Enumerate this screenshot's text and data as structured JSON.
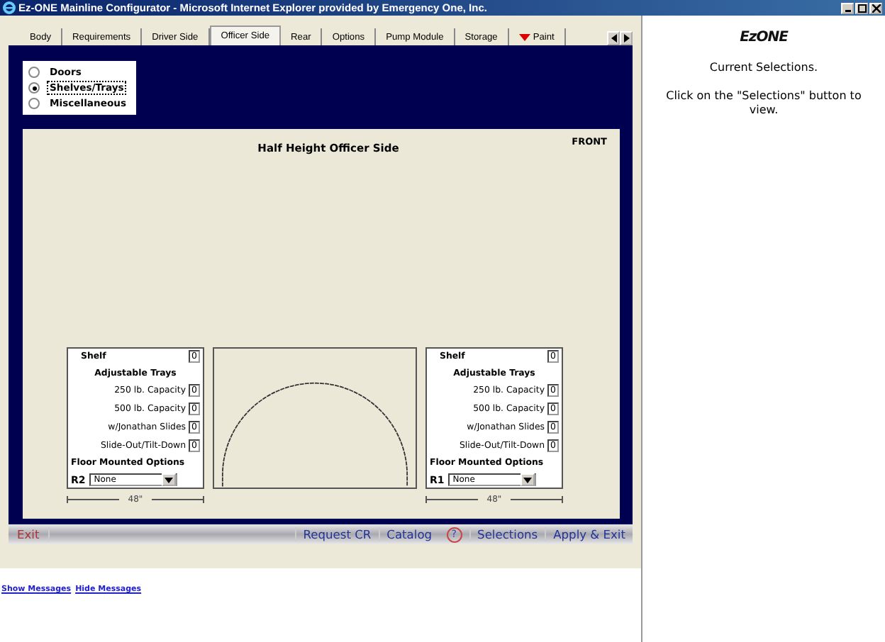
{
  "window": {
    "title": "Ez-ONE Mainline Configurator - Microsoft Internet Explorer provided by Emergency One, Inc."
  },
  "tabs": [
    {
      "label": "Body",
      "selected": false
    },
    {
      "label": "Requirements",
      "selected": false
    },
    {
      "label": "Driver Side",
      "selected": false
    },
    {
      "label": "Officer Side",
      "selected": true
    },
    {
      "label": "Rear",
      "selected": false
    },
    {
      "label": "Options",
      "selected": false
    },
    {
      "label": "Pump Module",
      "selected": false
    },
    {
      "label": "Storage",
      "selected": false
    },
    {
      "label": "Paint",
      "selected": false
    }
  ],
  "view_options": [
    {
      "label": "Doors",
      "selected": false
    },
    {
      "label": "Shelves/Trays",
      "selected": true
    },
    {
      "label": "Miscellaneous",
      "selected": false
    }
  ],
  "canvas": {
    "title": "Half Height Officer Side",
    "front_label": "FRONT",
    "panels": [
      {
        "shelf_label": "Shelf",
        "shelf_value": "0",
        "trays_heading": "Adjustable Trays",
        "rows": [
          {
            "label": "250 lb. Capacity",
            "value": "0"
          },
          {
            "label": "500 lb. Capacity",
            "value": "0"
          },
          {
            "label": "w/Jonathan Slides",
            "value": "0"
          },
          {
            "label": "Slide-Out/Tilt-Down",
            "value": "0"
          }
        ],
        "floor_heading": "Floor Mounted Options",
        "position": "R2",
        "floor_option": "None",
        "dimension": "48\""
      },
      {
        "shelf_label": "Shelf",
        "shelf_value": "0",
        "trays_heading": "Adjustable Trays",
        "rows": [
          {
            "label": "250 lb. Capacity",
            "value": "0"
          },
          {
            "label": "500 lb. Capacity",
            "value": "0"
          },
          {
            "label": "w/Jonathan Slides",
            "value": "0"
          },
          {
            "label": "Slide-Out/Tilt-Down",
            "value": "0"
          }
        ],
        "floor_heading": "Floor Mounted Options",
        "position": "R1",
        "floor_option": "None",
        "dimension": "48\""
      }
    ]
  },
  "toolbar": {
    "exit": "Exit",
    "buttons": [
      "Request CR",
      "Catalog"
    ],
    "help": "?",
    "buttons_right": [
      "Selections",
      "Apply & Exit"
    ]
  },
  "messages_links": [
    "Show Messages",
    "Hide Messages"
  ],
  "side_panel": {
    "logo": "EzONE",
    "heading": "Current Selections.",
    "text": "Click on the \"Selections\" button to view."
  }
}
